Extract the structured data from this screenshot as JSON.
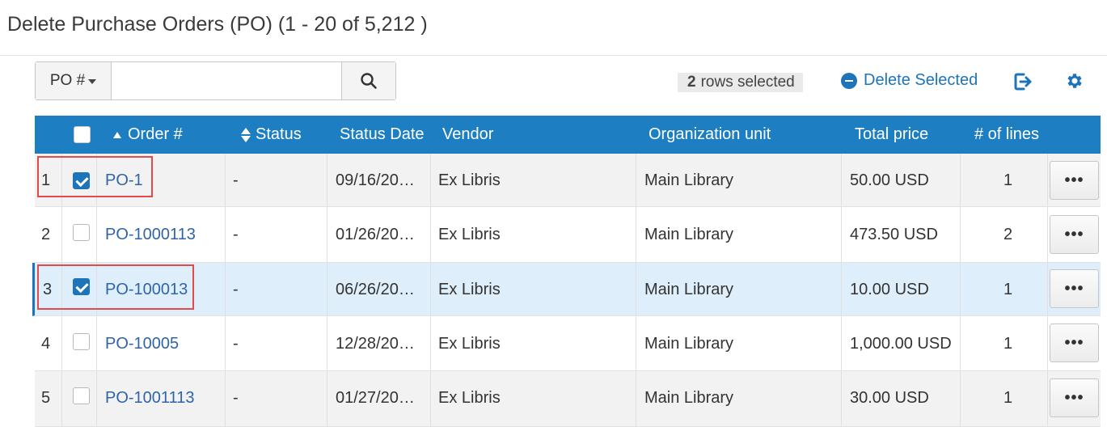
{
  "page": {
    "title": "Delete Purchase Orders (PO) (1 - 20 of 5,212 )"
  },
  "search": {
    "scope_label": "PO #",
    "value": "",
    "placeholder": ""
  },
  "toolbar": {
    "rows_selected_count": "2",
    "rows_selected_text": "rows selected",
    "delete_selected_label": "Delete Selected"
  },
  "colors": {
    "header_bg": "#1d7ec1",
    "accent": "#1e74b9",
    "link": "#2f64a8",
    "highlight_row": "#dfeefb",
    "annotation_box": "#e34b4b"
  },
  "table": {
    "columns": {
      "order": "Order #",
      "status": "Status",
      "status_date": "Status Date",
      "vendor": "Vendor",
      "org_unit": "Organization unit",
      "total_price": "Total price",
      "lines": "# of lines"
    },
    "rows": [
      {
        "index": "1",
        "checked": true,
        "order": "PO-1",
        "status": "-",
        "status_date": "09/16/20…",
        "vendor": "Ex Libris",
        "org_unit": "Main Library",
        "total_price": "50.00 USD",
        "lines": "1",
        "more": "•••"
      },
      {
        "index": "2",
        "checked": false,
        "order": "PO-1000113",
        "status": "-",
        "status_date": "01/26/20…",
        "vendor": "Ex Libris",
        "org_unit": "Main Library",
        "total_price": "473.50 USD",
        "lines": "2",
        "more": "•••"
      },
      {
        "index": "3",
        "checked": true,
        "order": "PO-100013",
        "status": "-",
        "status_date": "06/26/20…",
        "vendor": "Ex Libris",
        "org_unit": "Main Library",
        "total_price": "10.00 USD",
        "lines": "1",
        "more": "•••"
      },
      {
        "index": "4",
        "checked": false,
        "order": "PO-10005",
        "status": "-",
        "status_date": "12/28/20…",
        "vendor": "Ex Libris",
        "org_unit": "Main Library",
        "total_price": "1,000.00 USD",
        "lines": "1",
        "more": "•••"
      },
      {
        "index": "5",
        "checked": false,
        "order": "PO-1001113",
        "status": "-",
        "status_date": "01/27/20…",
        "vendor": "Ex Libris",
        "org_unit": "Main Library",
        "total_price": "30.00 USD",
        "lines": "1",
        "more": "•••"
      }
    ]
  }
}
